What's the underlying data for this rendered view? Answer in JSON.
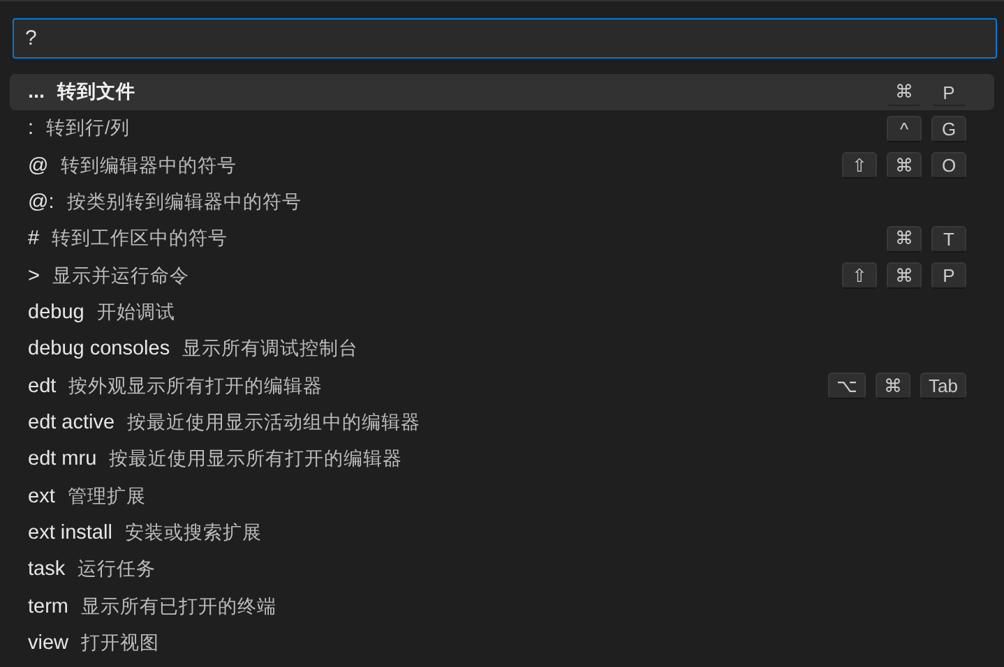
{
  "search": {
    "value": "?"
  },
  "items": [
    {
      "prefix": "...",
      "label": "转到文件",
      "keys": [
        "⌘",
        "P"
      ],
      "selected": true
    },
    {
      "prefix": ":",
      "label": "转到行/列",
      "keys": [
        "^",
        "G"
      ],
      "selected": false
    },
    {
      "prefix": "@",
      "label": "转到编辑器中的符号",
      "keys": [
        "⇧",
        "⌘",
        "O"
      ],
      "selected": false
    },
    {
      "prefix": "@:",
      "label": "按类别转到编辑器中的符号",
      "selected": false
    },
    {
      "prefix": "#",
      "label": "转到工作区中的符号",
      "keys": [
        "⌘",
        "T"
      ],
      "selected": false
    },
    {
      "prefix": ">",
      "label": "显示并运行命令",
      "keys": [
        "⇧",
        "⌘",
        "P"
      ],
      "selected": false
    },
    {
      "prefix": "debug",
      "label": "开始调试",
      "selected": false
    },
    {
      "prefix": "debug consoles",
      "label": "显示所有调试控制台",
      "selected": false
    },
    {
      "prefix": "edt",
      "label": "按外观显示所有打开的编辑器",
      "keys": [
        "⌥",
        "⌘",
        "Tab"
      ],
      "selected": false
    },
    {
      "prefix": "edt active",
      "label": "按最近使用显示活动组中的编辑器",
      "selected": false
    },
    {
      "prefix": "edt mru",
      "label": "按最近使用显示所有打开的编辑器",
      "selected": false
    },
    {
      "prefix": "ext",
      "label": "管理扩展",
      "selected": false
    },
    {
      "prefix": "ext install",
      "label": "安装或搜索扩展",
      "selected": false
    },
    {
      "prefix": "task",
      "label": "运行任务",
      "selected": false
    },
    {
      "prefix": "term",
      "label": "显示所有已打开的终端",
      "selected": false
    },
    {
      "prefix": "view",
      "label": "打开视图",
      "selected": false
    }
  ]
}
